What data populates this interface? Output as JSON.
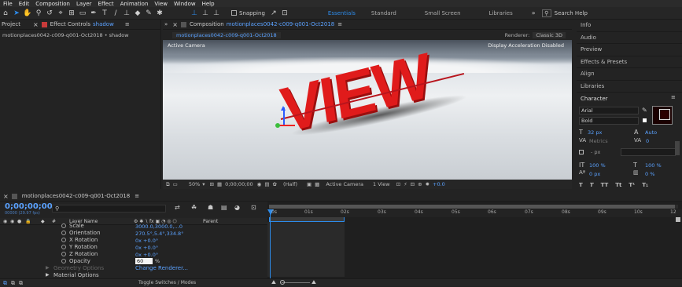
{
  "menu": [
    "File",
    "Edit",
    "Composition",
    "Layer",
    "Effect",
    "Animation",
    "View",
    "Window",
    "Help"
  ],
  "toolbar": {
    "snapping": "Snapping",
    "workspaces": [
      "Essentials",
      "Standard",
      "Small Screen",
      "Libraries"
    ],
    "search_placeholder": "Search Help"
  },
  "project": {
    "tab": "Project",
    "effect_controls": "Effect Controls",
    "effect_target": "shadow",
    "breadcrumb": "motionplaces0042-c009-q001-Oct2018 • shadow"
  },
  "composition": {
    "tab_prefix": "Composition",
    "tab_name": "motionplaces0042-c009-q001-Oct2018",
    "subtab": "motionplaces0042-c009-q001-Oct2018",
    "renderer_label": "Renderer:",
    "renderer": "Classic 3D",
    "active_camera": "Active Camera",
    "accel_note": "Display Acceleration Disabled",
    "viewer_text": "VIEW"
  },
  "viewer_bar": {
    "zoom": "50%",
    "timecode": "0;00;00;00",
    "resolution": "(Half)",
    "camera": "Active Camera",
    "views": "1 View",
    "exposure": "+0.0"
  },
  "right_panel": {
    "items": [
      "Info",
      "Audio",
      "Preview",
      "Effects & Presets",
      "Align",
      "Libraries"
    ],
    "character": "Character",
    "font": "Arial",
    "style": "Bold",
    "size": "32 px",
    "leading": "Auto",
    "kerning": "Metrics",
    "tracking": "0",
    "stroke": "- px",
    "vscale": "100 %",
    "hscale": "100 %",
    "baseline": "0 px",
    "tsume": "0 %",
    "styles": [
      "T",
      "T",
      "TT",
      "Tt",
      "T¹",
      "T₁"
    ]
  },
  "timeline": {
    "tab": "motionplaces0042-c009-q001-Oct2018",
    "timecode": "0;00;00;00",
    "fps": "00000 (29.97 fps)",
    "col_layer": "Layer Name",
    "col_parent": "Parent",
    "toggle": "Toggle Switches / Modes",
    "props": [
      {
        "name": "Scale",
        "value": "3000.0,3000.0,...0"
      },
      {
        "name": "Orientation",
        "value": "270.5°,5.4°,334.8°"
      },
      {
        "name": "X Rotation",
        "value": "0x +0.0°"
      },
      {
        "name": "Y Rotation",
        "value": "0x +0.0°"
      },
      {
        "name": "Z Rotation",
        "value": "0x +0.0°"
      },
      {
        "name": "Opacity",
        "value": "60",
        "unit": "%"
      }
    ],
    "geometry": "Geometry Options",
    "change_renderer": "Change Renderer...",
    "material": "Material Options",
    "ruler": [
      "0s",
      "01s",
      "02s",
      "03s",
      "04s",
      "05s",
      "06s",
      "07s",
      "08s",
      "09s",
      "10s",
      "12"
    ]
  },
  "colors": {
    "accent": "#2d8ceb",
    "text_red": "#e01b1b"
  }
}
